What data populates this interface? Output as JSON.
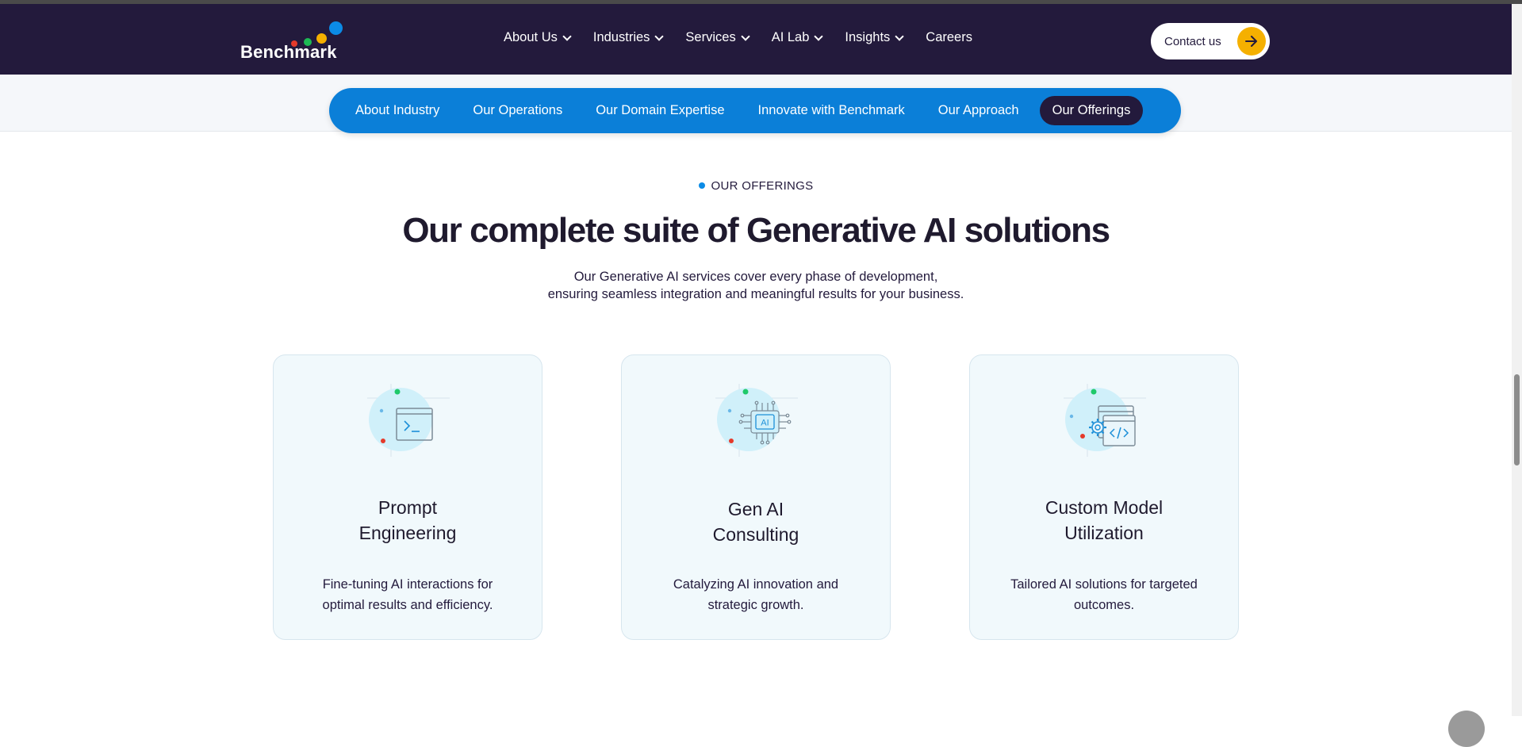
{
  "brand": {
    "name": "Benchmark",
    "accent": "#0b7fd8",
    "dark": "#231a3c",
    "cta_color": "#f5b000"
  },
  "nav": {
    "items": [
      {
        "label": "About Us",
        "dropdown": true
      },
      {
        "label": "Industries",
        "dropdown": true
      },
      {
        "label": "Services",
        "dropdown": true
      },
      {
        "label": "AI Lab",
        "dropdown": true
      },
      {
        "label": "Insights",
        "dropdown": true
      },
      {
        "label": "Careers",
        "dropdown": false
      }
    ],
    "contact_label": "Contact us",
    "contact_icon": "arrow-right-icon"
  },
  "subnav": {
    "items": [
      "About Industry",
      "Our Operations",
      "Our Domain Expertise",
      "Innovate with Benchmark",
      "Our Approach",
      "Our Offerings"
    ],
    "active": "Our Offerings"
  },
  "section": {
    "eyebrow": "OUR OFFERINGS",
    "headline": "Our complete suite of Generative AI solutions",
    "desc_line1": "Our Generative AI services cover every phase of development,",
    "desc_line2": "ensuring seamless integration and meaningful results for your business."
  },
  "cards": [
    {
      "title_line1": "Prompt",
      "title_line2": "Engineering",
      "text_line1": "Fine-tuning AI interactions for",
      "text_line2": "optimal results and efficiency.",
      "icon": "terminal-window-icon"
    },
    {
      "title_line1": "Gen AI",
      "title_line2": "Consulting",
      "text_line1": "Catalyzing AI innovation and",
      "text_line2": "strategic growth.",
      "icon": "ai-chip-icon"
    },
    {
      "title_line1": "Custom Model",
      "title_line2": "Utilization",
      "text_line1": "Tailored AI solutions for targeted",
      "text_line2": "outcomes.",
      "icon": "code-settings-icon"
    }
  ],
  "icon_label_ai": "AI"
}
